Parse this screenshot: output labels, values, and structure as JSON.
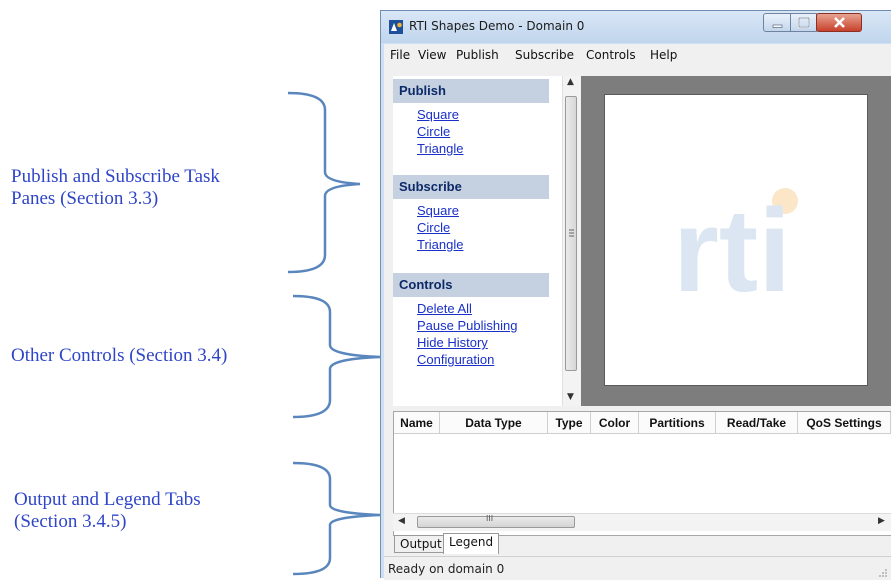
{
  "annotations": {
    "publish_subscribe": [
      "Publish and Subscribe Task",
      "Panes (Section 3.3)"
    ],
    "other_controls": "Other Controls (Section 3.4)",
    "output_legend": [
      "Output and Legend Tabs",
      "(Section 3.4.5)"
    ]
  },
  "window": {
    "title": "RTI Shapes Demo - Domain 0",
    "menu": [
      "File",
      "View",
      "Publish",
      "Subscribe",
      "Controls",
      "Help"
    ]
  },
  "task_pane": {
    "publish": {
      "header": "Publish",
      "links": [
        "Square",
        "Circle",
        "Triangle"
      ]
    },
    "subscribe": {
      "header": "Subscribe",
      "links": [
        "Square",
        "Circle",
        "Triangle"
      ]
    },
    "controls": {
      "header": "Controls",
      "links": [
        "Delete All",
        "Pause Publishing",
        "Hide History",
        "Configuration"
      ]
    }
  },
  "canvas": {
    "logo_text": "rti",
    "logo_color": "#dbe6f2",
    "dot_color": "#fbe6c8"
  },
  "table": {
    "columns": [
      "Name",
      "Data Type",
      "Type",
      "Color",
      "Partitions",
      "Read/Take",
      "QoS Settings"
    ]
  },
  "scroll_glyph": "III",
  "tabs": [
    "Output",
    "Legend"
  ],
  "status": "Ready on domain 0",
  "colors": {
    "annotation": "#2f45c8",
    "link": "#1a30c8",
    "pane_header": "#c5d1e0",
    "brace": "#5a86be"
  }
}
